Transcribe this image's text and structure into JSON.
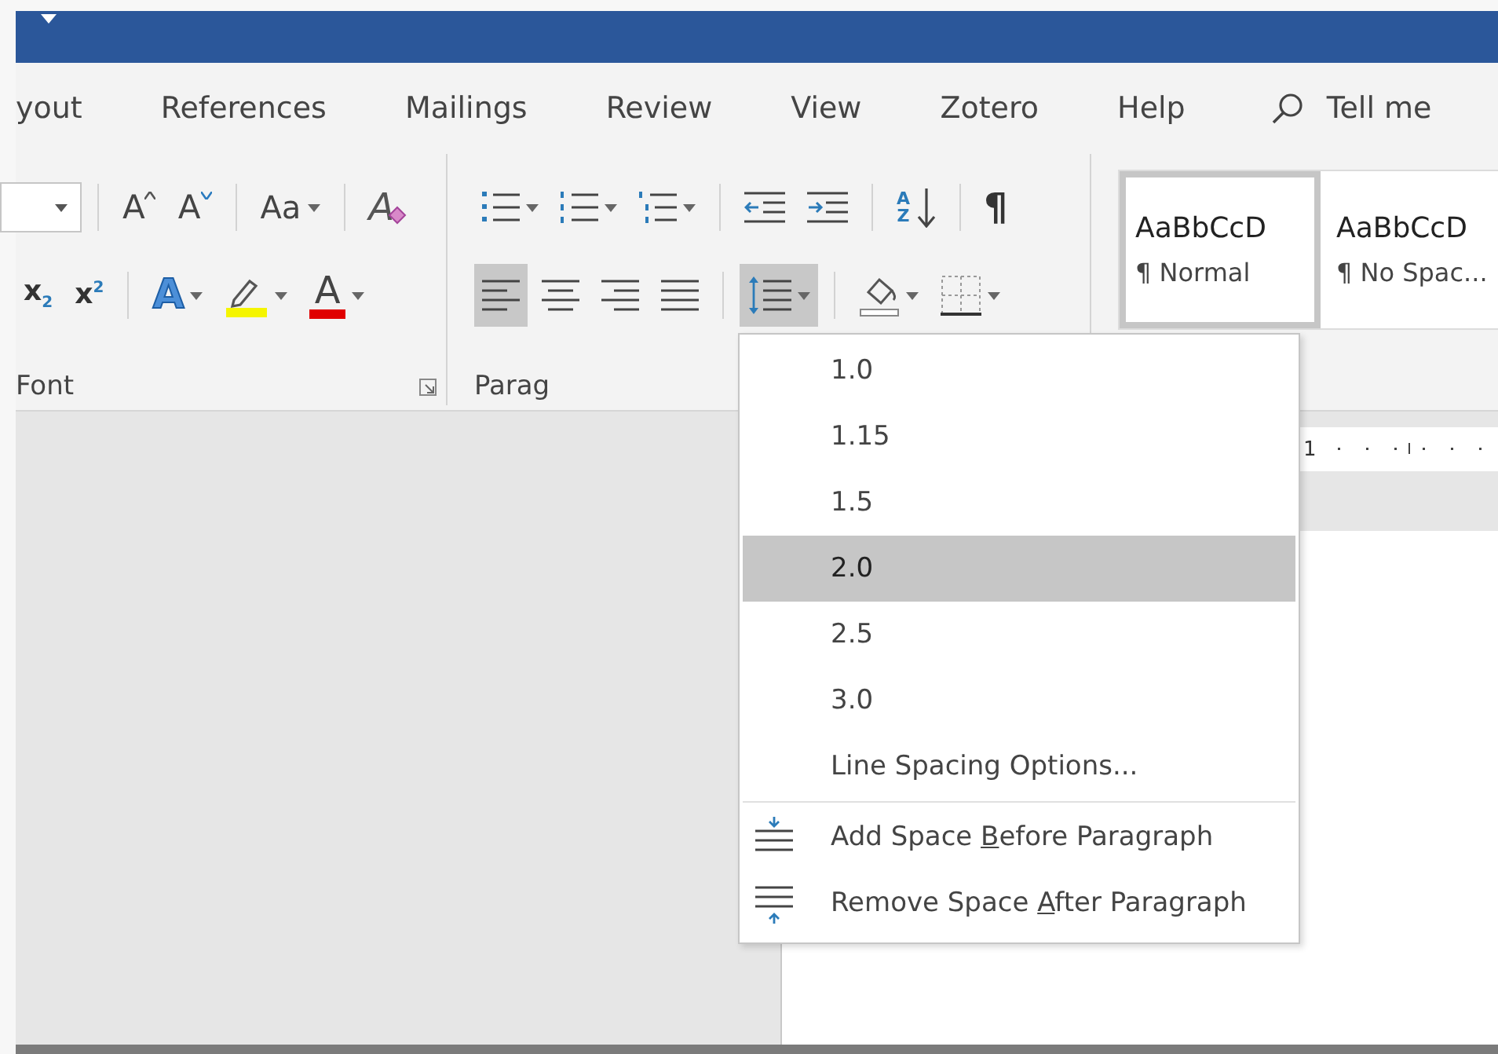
{
  "tabs": [
    {
      "label": "yout",
      "selected": false
    },
    {
      "label": "References",
      "selected": false
    },
    {
      "label": "Mailings",
      "selected": false
    },
    {
      "label": "Review",
      "selected": false
    },
    {
      "label": "View",
      "selected": false
    },
    {
      "label": "Zotero",
      "selected": false
    },
    {
      "label": "Help",
      "selected": false
    }
  ],
  "tell_me": "Tell me",
  "font_group": {
    "label": "Font",
    "row1": [
      [
        {
          "kind": "size"
        }
      ],
      [
        {
          "kind": "grow",
          "label": "A"
        },
        {
          "kind": "shrink",
          "label": "A"
        }
      ],
      [
        {
          "kind": "case",
          "label": "Aa",
          "dropdown": true
        }
      ],
      [
        {
          "kind": "clear",
          "label": "A"
        }
      ]
    ],
    "row2": [
      [
        {
          "kind": "sub",
          "label": "x$_{2}$"
        },
        {
          "kind": "sup",
          "label": "x$^{2}$"
        }
      ],
      [
        {
          "kind": "effects",
          "label": "A",
          "dropdown": true
        },
        {
          "kind": "highlight",
          "dropdown": true
        },
        {
          "kind": "color",
          "label": "A",
          "dropdown": true
        }
      ]
    ]
  },
  "paragraph_group": {
    "label": "Parag",
    "row1": [
      [
        {
          "kind": "bullets",
          "dropdown": true
        },
        {
          "kind": "numbering",
          "dropdown": true
        },
        {
          "kind": "multilevel",
          "dropdown": true
        }
      ],
      [
        {
          "kind": "outdent"
        },
        {
          "kind": "indent"
        }
      ],
      [
        {
          "kind": "sort",
          "top": "A",
          "bottom": "Z"
        }
      ],
      [
        {
          "kind": "pilcrow",
          "label": "¶"
        }
      ]
    ],
    "row2": [
      [
        {
          "kind": "align-left",
          "selected": true
        },
        {
          "kind": "align-center",
          "selected": false
        },
        {
          "kind": "align-right",
          "selected": false
        },
        {
          "kind": "justify",
          "selected": false
        }
      ],
      [
        {
          "kind": "line-spacing",
          "dropdown": true,
          "selected": true
        }
      ],
      [
        {
          "kind": "shading",
          "dropdown": true,
          "selected": false
        },
        {
          "kind": "borders",
          "dropdown": true,
          "selected": false
        }
      ]
    ]
  },
  "styles": [
    {
      "sample": "AaBbCcD",
      "name": "¶ Normal",
      "selected": true
    },
    {
      "sample": "AaBbCcD",
      "name": "¶ No Spac...",
      "selected": false
    }
  ],
  "ruler": {
    "label": "1"
  },
  "line_spacing_menu": [
    {
      "kind": "value",
      "label": "1.0",
      "selected": false
    },
    {
      "kind": "value",
      "label": "1.15",
      "selected": false
    },
    {
      "kind": "value",
      "label": "1.5",
      "selected": false
    },
    {
      "kind": "value",
      "label": "2.0",
      "selected": true
    },
    {
      "kind": "value",
      "label": "2.5",
      "selected": false
    },
    {
      "kind": "value",
      "label": "3.0",
      "selected": false
    },
    {
      "kind": "option",
      "label": "Line Spacing Options..."
    },
    {
      "kind": "add-before",
      "before": "Add Space ",
      "key": "B",
      "after": "efore Paragraph"
    },
    {
      "kind": "remove-after",
      "before": "Remove Space ",
      "key": "A",
      "after": "fter Paragraph"
    }
  ]
}
